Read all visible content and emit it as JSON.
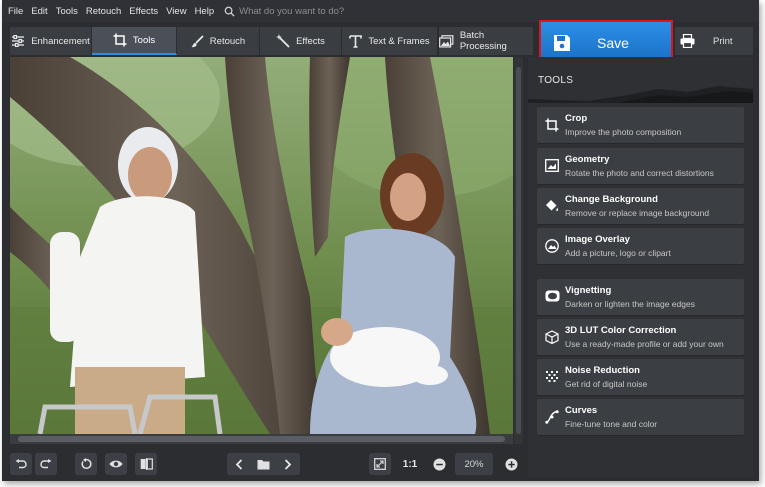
{
  "menu": [
    "File",
    "Edit",
    "Tools",
    "Retouch",
    "Effects",
    "View",
    "Help"
  ],
  "search": {
    "placeholder": "What do you want to do?",
    "icon": "search-icon"
  },
  "tabs": [
    {
      "label": "Enhancement",
      "icon": "sliders-icon",
      "active": false
    },
    {
      "label": "Tools",
      "icon": "crop-icon",
      "active": true
    },
    {
      "label": "Retouch",
      "icon": "brush-icon",
      "active": false
    },
    {
      "label": "Effects",
      "icon": "magic-wand-icon",
      "active": false
    },
    {
      "label": "Text & Frames",
      "icon": "text-icon",
      "active": false
    },
    {
      "label": "Batch Processing",
      "icon": "images-icon",
      "active": false
    }
  ],
  "save": {
    "label": "Save",
    "icon": "floppy-disk-icon",
    "highlight_color": "#e0141e"
  },
  "print": {
    "label": "Print",
    "icon": "printer-icon"
  },
  "panel": {
    "title": "TOOLS",
    "tools": [
      {
        "title": "Crop",
        "desc": "Improve the photo composition",
        "icon": "crop-icon"
      },
      {
        "title": "Geometry",
        "desc": "Rotate the photo and correct distortions",
        "icon": "geometry-icon"
      },
      {
        "title": "Change Background",
        "desc": "Remove or replace image background",
        "icon": "paint-bucket-icon"
      },
      {
        "title": "Image Overlay",
        "desc": "Add a picture, logo or clipart",
        "icon": "image-overlay-icon"
      },
      {
        "title": "Vignetting",
        "desc": "Darken or lighten the image edges",
        "icon": "vignette-icon"
      },
      {
        "title": "3D LUT Color Correction",
        "desc": "Use a ready-made profile or add your own",
        "icon": "cube-icon"
      },
      {
        "title": "Noise Reduction",
        "desc": "Get rid of digital noise",
        "icon": "noise-icon"
      },
      {
        "title": "Curves",
        "desc": "Fine-tune tone and color",
        "icon": "curves-icon"
      }
    ]
  },
  "bottom": {
    "actual_size_label": "1:1",
    "zoom": "20%"
  },
  "colors": {
    "accent": "#2f8be0",
    "background": "#2b2d31",
    "card": "#3b3e43"
  }
}
